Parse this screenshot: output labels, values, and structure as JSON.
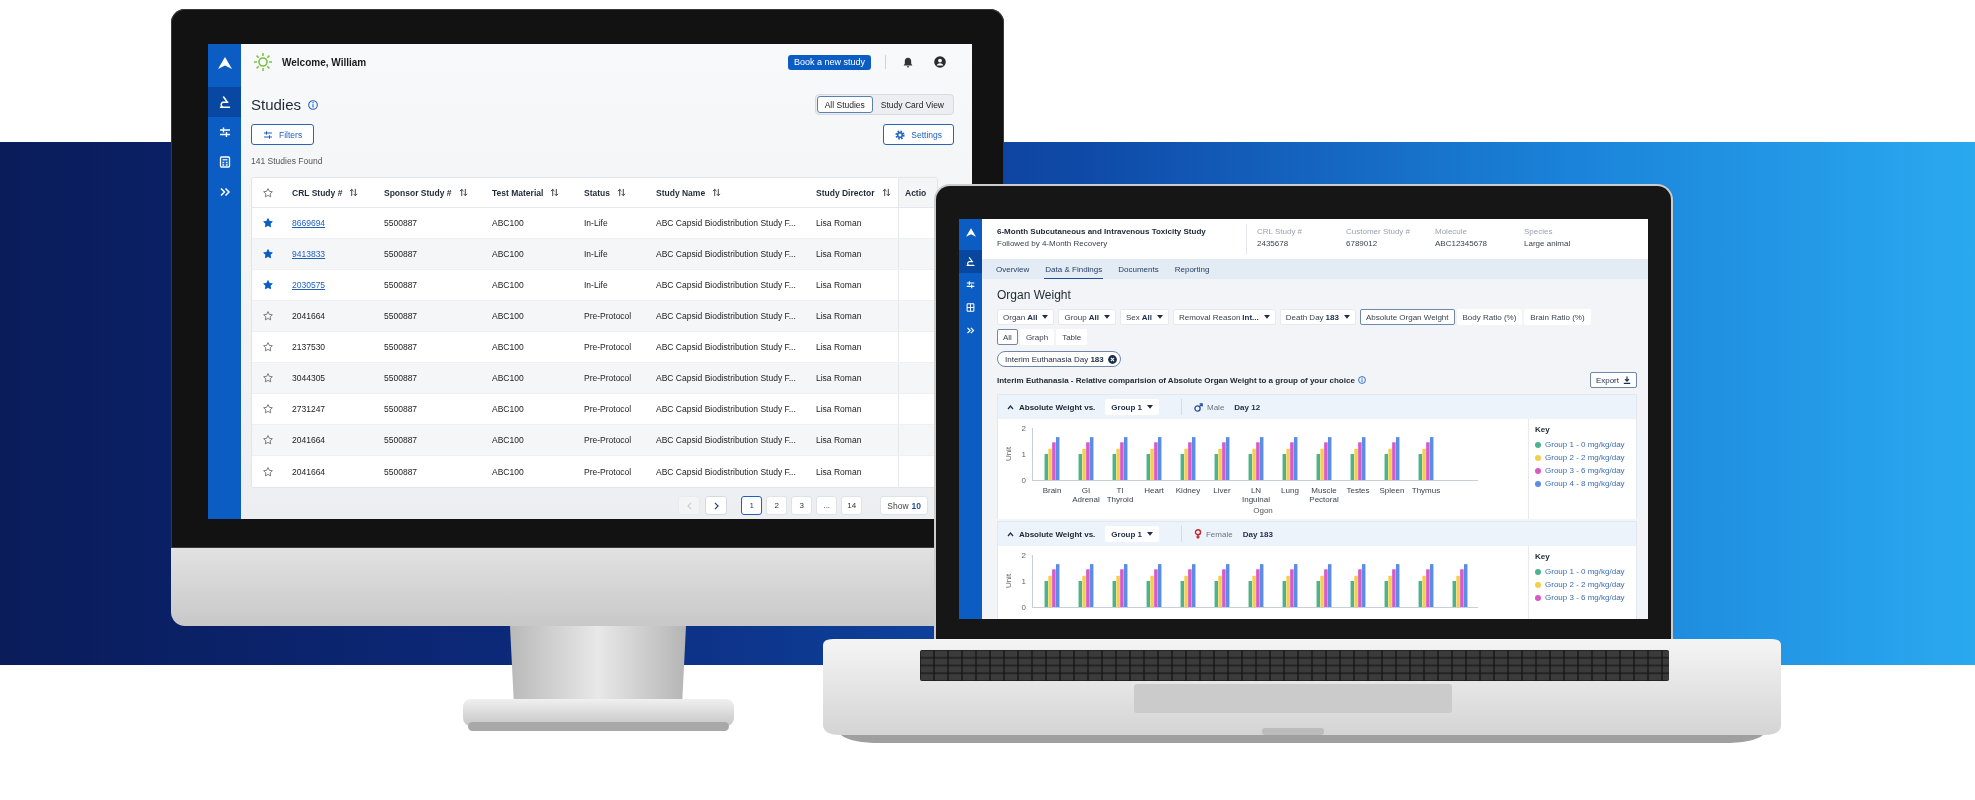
{
  "monitor": {
    "sidebar": {
      "items": [
        {
          "kind": "microscope",
          "selected": true
        },
        {
          "kind": "sliders",
          "selected": false
        },
        {
          "kind": "calculator",
          "selected": false
        },
        {
          "kind": "chevrons",
          "selected": false
        }
      ]
    },
    "header": {
      "greeting": "Welcome, William",
      "action_button": "Book a new study"
    },
    "page": {
      "title": "Studies",
      "views": [
        {
          "label": "All Studies",
          "selected": true
        },
        {
          "label": "Study Card View",
          "selected": false
        }
      ],
      "filters_button": "Filters",
      "settings_button": "Settings",
      "result_count": "141 Studies Found"
    },
    "table": {
      "columns": [
        {
          "label": "CRL Study #",
          "sortable": true
        },
        {
          "label": "Sponsor Study #",
          "sortable": true
        },
        {
          "label": "Test Material",
          "sortable": true
        },
        {
          "label": "Status",
          "sortable": true
        },
        {
          "label": "Study Name",
          "sortable": true
        },
        {
          "label": "Study Director",
          "sortable": true
        },
        {
          "label": "Actio",
          "sortable": false
        }
      ],
      "rows": [
        {
          "starred": true,
          "link": true,
          "cells": [
            "8669694",
            "5500887",
            "ABC100",
            "In-Life",
            "ABC Capsid Biodistribution Study F...",
            "Lisa Roman"
          ]
        },
        {
          "starred": true,
          "link": true,
          "cells": [
            "9413833",
            "5500887",
            "ABC100",
            "In-Life",
            "ABC Capsid Biodistribution Study F...",
            "Lisa Roman"
          ]
        },
        {
          "starred": true,
          "link": true,
          "cells": [
            "2030575",
            "5500887",
            "ABC100",
            "In-Life",
            "ABC Capsid Biodistribution Study F...",
            "Lisa Roman"
          ]
        },
        {
          "starred": false,
          "link": false,
          "cells": [
            "2041664",
            "5500887",
            "ABC100",
            "Pre-Protocol",
            "ABC Capsid Biodistribution Study F...",
            "Lisa Roman"
          ]
        },
        {
          "starred": false,
          "link": false,
          "cells": [
            "2137530",
            "5500887",
            "ABC100",
            "Pre-Protocol",
            "ABC Capsid Biodistribution Study F...",
            "Lisa Roman"
          ]
        },
        {
          "starred": false,
          "link": false,
          "cells": [
            "3044305",
            "5500887",
            "ABC100",
            "Pre-Protocol",
            "ABC Capsid Biodistribution Study F...",
            "Lisa Roman"
          ]
        },
        {
          "starred": false,
          "link": false,
          "cells": [
            "2731247",
            "5500887",
            "ABC100",
            "Pre-Protocol",
            "ABC Capsid Biodistribution Study F...",
            "Lisa Roman"
          ]
        },
        {
          "starred": false,
          "link": false,
          "cells": [
            "2041664",
            "5500887",
            "ABC100",
            "Pre-Protocol",
            "ABC Capsid Biodistribution Study F...",
            "Lisa Roman"
          ]
        },
        {
          "starred": false,
          "link": false,
          "cells": [
            "2041664",
            "5500887",
            "ABC100",
            "Pre-Protocol",
            "ABC Capsid Biodistribution Study F...",
            "Lisa Roman"
          ]
        }
      ]
    },
    "pagination": {
      "previous": {
        "disabled": true
      },
      "next": {
        "disabled": false
      },
      "pages": [
        {
          "label": "1",
          "selected": true
        },
        {
          "label": "2",
          "selected": false
        },
        {
          "label": "3",
          "selected": false
        },
        {
          "label": "...",
          "selected": false
        },
        {
          "label": "14",
          "selected": false
        }
      ],
      "page_size": {
        "label": "Show",
        "value": "10"
      }
    }
  },
  "laptop": {
    "sidebar": {
      "items": [
        {
          "kind": "microscope",
          "selected": true
        },
        {
          "kind": "sliders",
          "selected": false
        },
        {
          "kind": "calculator",
          "selected": false
        },
        {
          "kind": "chevrons",
          "selected": false
        }
      ]
    },
    "study": {
      "title": "6-Month Subcutaneous and Intravenous Toxicity Study",
      "subtitle": "Followed by 4-Month Recovery",
      "fields": [
        {
          "label": "CRL Study #",
          "value": "2435678"
        },
        {
          "label": "Customer Study #",
          "value": "6789012"
        },
        {
          "label": "Molecule",
          "value": "ABC12345678"
        },
        {
          "label": "Species",
          "value": "Large animal"
        }
      ]
    },
    "tabs": [
      {
        "label": "Overview",
        "selected": false
      },
      {
        "label": "Data & Findings",
        "selected": true
      },
      {
        "label": "Documents",
        "selected": false
      },
      {
        "label": "Reporting",
        "selected": false
      }
    ],
    "section_title": "Organ Weight",
    "filters": [
      {
        "label": "Organ",
        "value": "All"
      },
      {
        "label": "Group",
        "value": "All"
      },
      {
        "label": "Sex",
        "value": "All"
      },
      {
        "label": "Removal Reason",
        "value": "Int..."
      },
      {
        "label": "Death Day",
        "value": "183"
      }
    ],
    "measures": [
      {
        "label": "Absolute Organ Weight",
        "selected": true
      },
      {
        "label": "Body Ratio (%)",
        "selected": false
      },
      {
        "label": "Brain Ratio (%)",
        "selected": false
      }
    ],
    "views": [
      {
        "label": "All",
        "selected": true
      },
      {
        "label": "Graph",
        "selected": false
      },
      {
        "label": "Table",
        "selected": false
      }
    ],
    "chips": [
      {
        "label": "Interim Euthanasia Day **183**"
      }
    ],
    "description": "Interim Euthanasia - Relative comparision of Absolute Organ Weight to a group of your choice",
    "export_button": "Export",
    "panels": [
      {
        "expanded": true,
        "title": "Absolute Weight vs.",
        "group": "Group 1",
        "kind": "male",
        "sex": "Male",
        "day": "Day 12",
        "legend_title": "Key",
        "chart_data": {
          "type": "bar",
          "xlabel": "Ogon",
          "ylabel": "Unit",
          "categories": [
            "Brain",
            "GI Adrenal",
            "TI Thyroid",
            "Heart",
            "Kidney",
            "Liver",
            "LN Inguinal",
            "Lung",
            "Muscle Pectoral",
            "Testes",
            "Spleen",
            "Thymus"
          ],
          "series": [
            {
              "name": "Group 1 - 0 mg/kg/day",
              "color": "#4db38e",
              "values": [
                1,
                1,
                1,
                1,
                1,
                1,
                1,
                1,
                1,
                1,
                1,
                1
              ]
            },
            {
              "name": "Group 2 - 2 mg/kg/day",
              "color": "#f4cf4a",
              "values": [
                1.2,
                1.2,
                1.2,
                1.2,
                1.2,
                1.2,
                1.2,
                1.2,
                1.2,
                1.2,
                1.2,
                1.2
              ]
            },
            {
              "name": "Group 3 - 6 mg/kg/day",
              "color": "#d85ac6",
              "values": [
                1.45,
                1.45,
                1.45,
                1.45,
                1.45,
                1.45,
                1.45,
                1.45,
                1.45,
                1.45,
                1.45,
                1.45
              ]
            },
            {
              "name": "Group 4 - 8 mg/kg/day",
              "color": "#5b8de4",
              "values": [
                1.65,
                1.65,
                1.65,
                1.65,
                1.65,
                1.65,
                1.65,
                1.65,
                1.65,
                1.65,
                1.65,
                1.65
              ]
            }
          ],
          "ylim": [
            0,
            2
          ],
          "yticks": [
            0,
            1,
            2
          ]
        }
      },
      {
        "expanded": true,
        "title": "Absolute Weight vs.",
        "group": "Group 1",
        "kind": "female",
        "sex": "Female",
        "day": "Day 183",
        "legend_title": "Key",
        "chart_data": {
          "type": "bar",
          "ylabel": "Unit",
          "series": [
            {
              "name": "Group 1 - 0 mg/kg/day",
              "color": "#4db38e",
              "values": [
                1,
                1,
                1,
                1,
                1,
                1,
                1,
                1,
                1,
                1,
                1,
                1,
                1
              ]
            },
            {
              "name": "Group 2 - 2 mg/kg/day",
              "color": "#f4cf4a",
              "values": [
                1.2,
                1.2,
                1.2,
                1.2,
                1.2,
                1.2,
                1.2,
                1.2,
                1.2,
                1.2,
                1.2,
                1.2,
                1.2
              ]
            },
            {
              "name": "Group 3 - 6 mg/kg/day",
              "color": "#d85ac6",
              "values": [
                1.45,
                1.45,
                1.45,
                1.45,
                1.45,
                1.45,
                1.45,
                1.45,
                1.45,
                1.45,
                1.45,
                1.45,
                1.45
              ]
            },
            {
              "color": "#5b8de4",
              "values": [
                1.65,
                1.65,
                1.65,
                1.65,
                1.65,
                1.65,
                1.65,
                1.65,
                1.65,
                1.65,
                1.65,
                1.65,
                1.65
              ]
            }
          ],
          "ylim": [
            0,
            2
          ],
          "yticks": [
            0,
            1,
            2
          ]
        }
      }
    ]
  }
}
